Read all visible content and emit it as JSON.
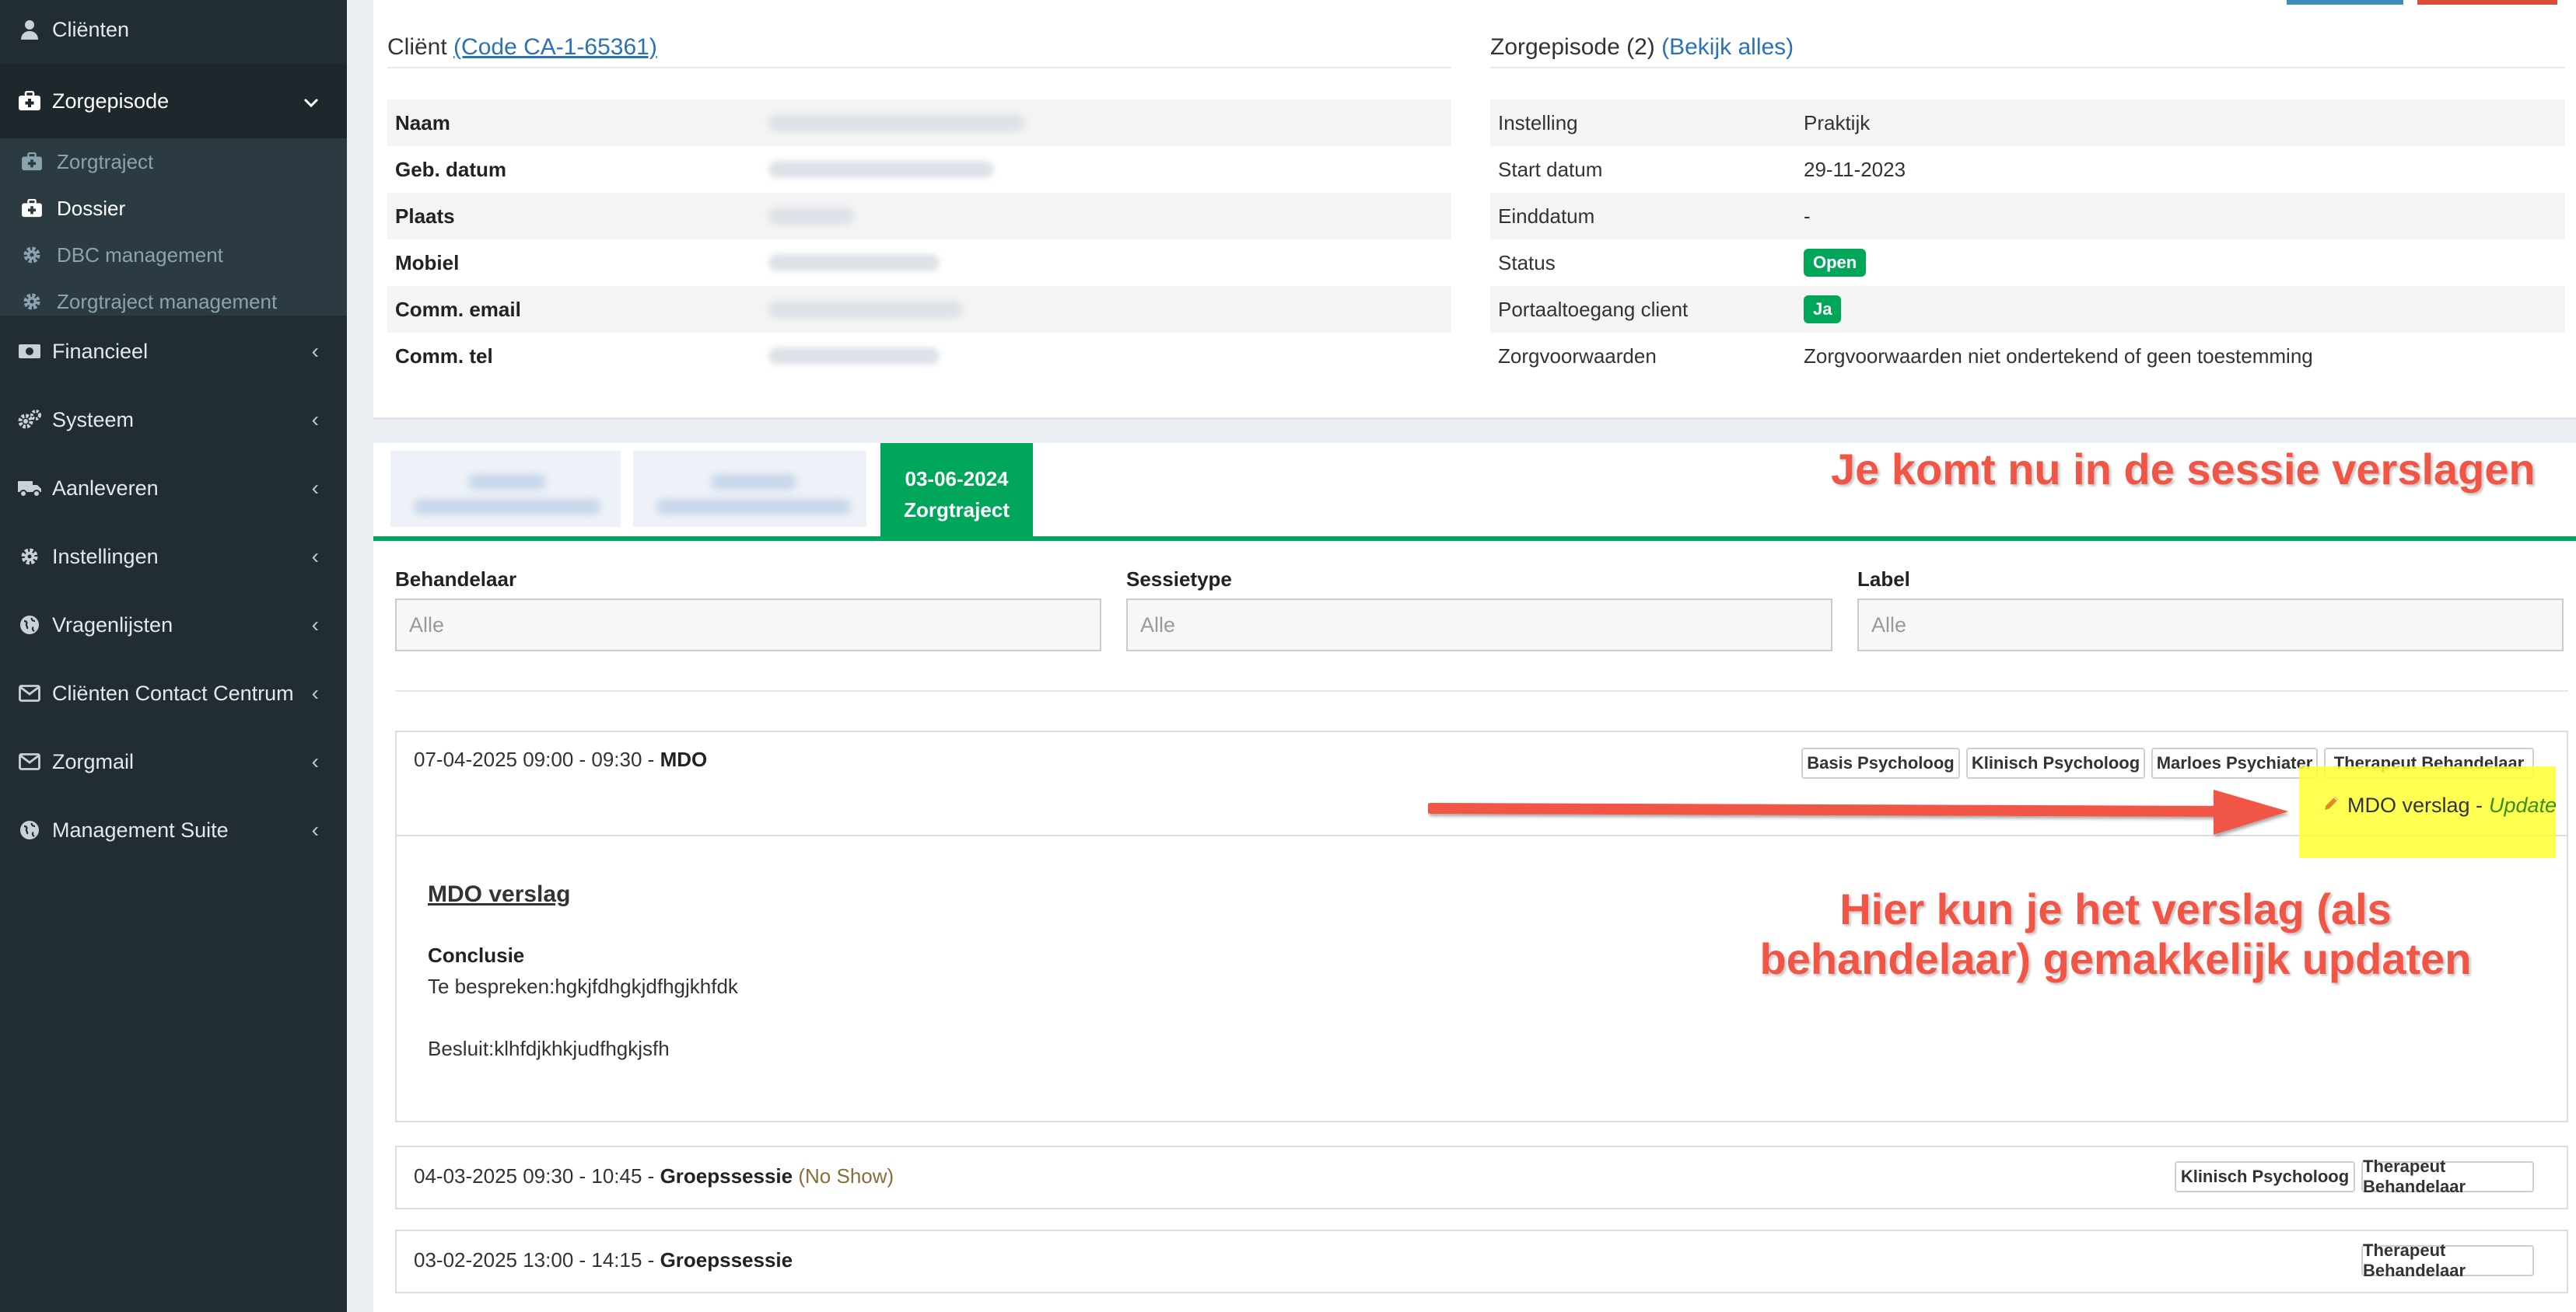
{
  "sidebar": {
    "items": [
      {
        "label": "Cliënten",
        "icon": "user-icon"
      },
      {
        "label": "Zorgepisode",
        "icon": "briefcase-medical-icon"
      },
      {
        "label": "Financieel",
        "icon": "money-icon"
      },
      {
        "label": "Systeem",
        "icon": "gears-icon"
      },
      {
        "label": "Aanleveren",
        "icon": "truck-icon"
      },
      {
        "label": "Instellingen",
        "icon": "cog-icon"
      },
      {
        "label": "Vragenlijsten",
        "icon": "globe-icon"
      },
      {
        "label": "Cliënten Contact Centrum",
        "icon": "envelope-icon"
      },
      {
        "label": "Zorgmail",
        "icon": "envelope-icon"
      },
      {
        "label": "Management Suite",
        "icon": "globe-icon"
      }
    ],
    "submenu": [
      {
        "label": "Zorgtraject",
        "icon": "briefcase-medical-icon"
      },
      {
        "label": "Dossier",
        "icon": "briefcase-medical-icon"
      },
      {
        "label": "DBC management",
        "icon": "cog-icon"
      },
      {
        "label": "Zorgtraject management",
        "icon": "cog-icon"
      }
    ]
  },
  "client": {
    "title": "Cliënt",
    "code_link": "(Code CA-1-65361)",
    "fields": [
      "Naam",
      "Geb. datum",
      "Plaats",
      "Mobiel",
      "Comm. email",
      "Comm. tel"
    ]
  },
  "episode": {
    "title": "Zorgepisode (2)",
    "view_all": "(Bekijk alles)",
    "rows": [
      {
        "key": "Instelling",
        "value": "Praktijk"
      },
      {
        "key": "Start datum",
        "value": "29-11-2023"
      },
      {
        "key": "Einddatum",
        "value": "-"
      },
      {
        "key": "Status",
        "value": "Open"
      },
      {
        "key": "Portaaltoegang client",
        "value": "Ja"
      },
      {
        "key": "Zorgvoorwaarden",
        "value": "Zorgvoorwaarden niet ondertekend of geen toestemming"
      }
    ]
  },
  "tabs": {
    "active_date": "03-06-2024",
    "active_label": "Zorgtraject"
  },
  "annotations": {
    "top": "Je komt nu in de sessie verslagen",
    "middle_line1": "Hier kun je het verslag (als",
    "middle_line2": "behandelaar) gemakkelijk updaten"
  },
  "filters": {
    "behandelaar": {
      "label": "Behandelaar",
      "value": "Alle"
    },
    "sessietype": {
      "label": "Sessietype",
      "value": "Alle"
    },
    "label": {
      "label": "Label",
      "value": "Alle"
    }
  },
  "sessions": [
    {
      "datetime": "07-04-2025 09:00 - 09:30 - ",
      "type": "MDO",
      "tags": [
        "Basis Psycholoog",
        "Klinisch Psycholoog",
        "Marloes Psychiater",
        "Therapeut Behandelaar"
      ],
      "action_text": "MDO verslag - ",
      "action_link": "Update",
      "report": {
        "title": "MDO verslag",
        "subtitle": "Conclusie",
        "line1": "Te bespreken:hgkjfdhgkjdfhgjkhfdk",
        "line2": "Besluit:klhfdjkhkjudfhgkjsfh"
      }
    },
    {
      "datetime": "04-03-2025 09:30 - 10:45 - ",
      "type": "Groepssessie",
      "status": "(No Show)",
      "tags": [
        "Klinisch Psycholoog",
        "Therapeut Behandelaar"
      ]
    },
    {
      "datetime": "03-02-2025 13:00 - 14:15 - ",
      "type": "Groepssessie",
      "tags": [
        "Therapeut Behandelaar"
      ]
    }
  ],
  "colors": {
    "accent": "#00a65a",
    "link": "#2a72b5",
    "sidebar": "#222d32",
    "annotation": "#f05545"
  }
}
